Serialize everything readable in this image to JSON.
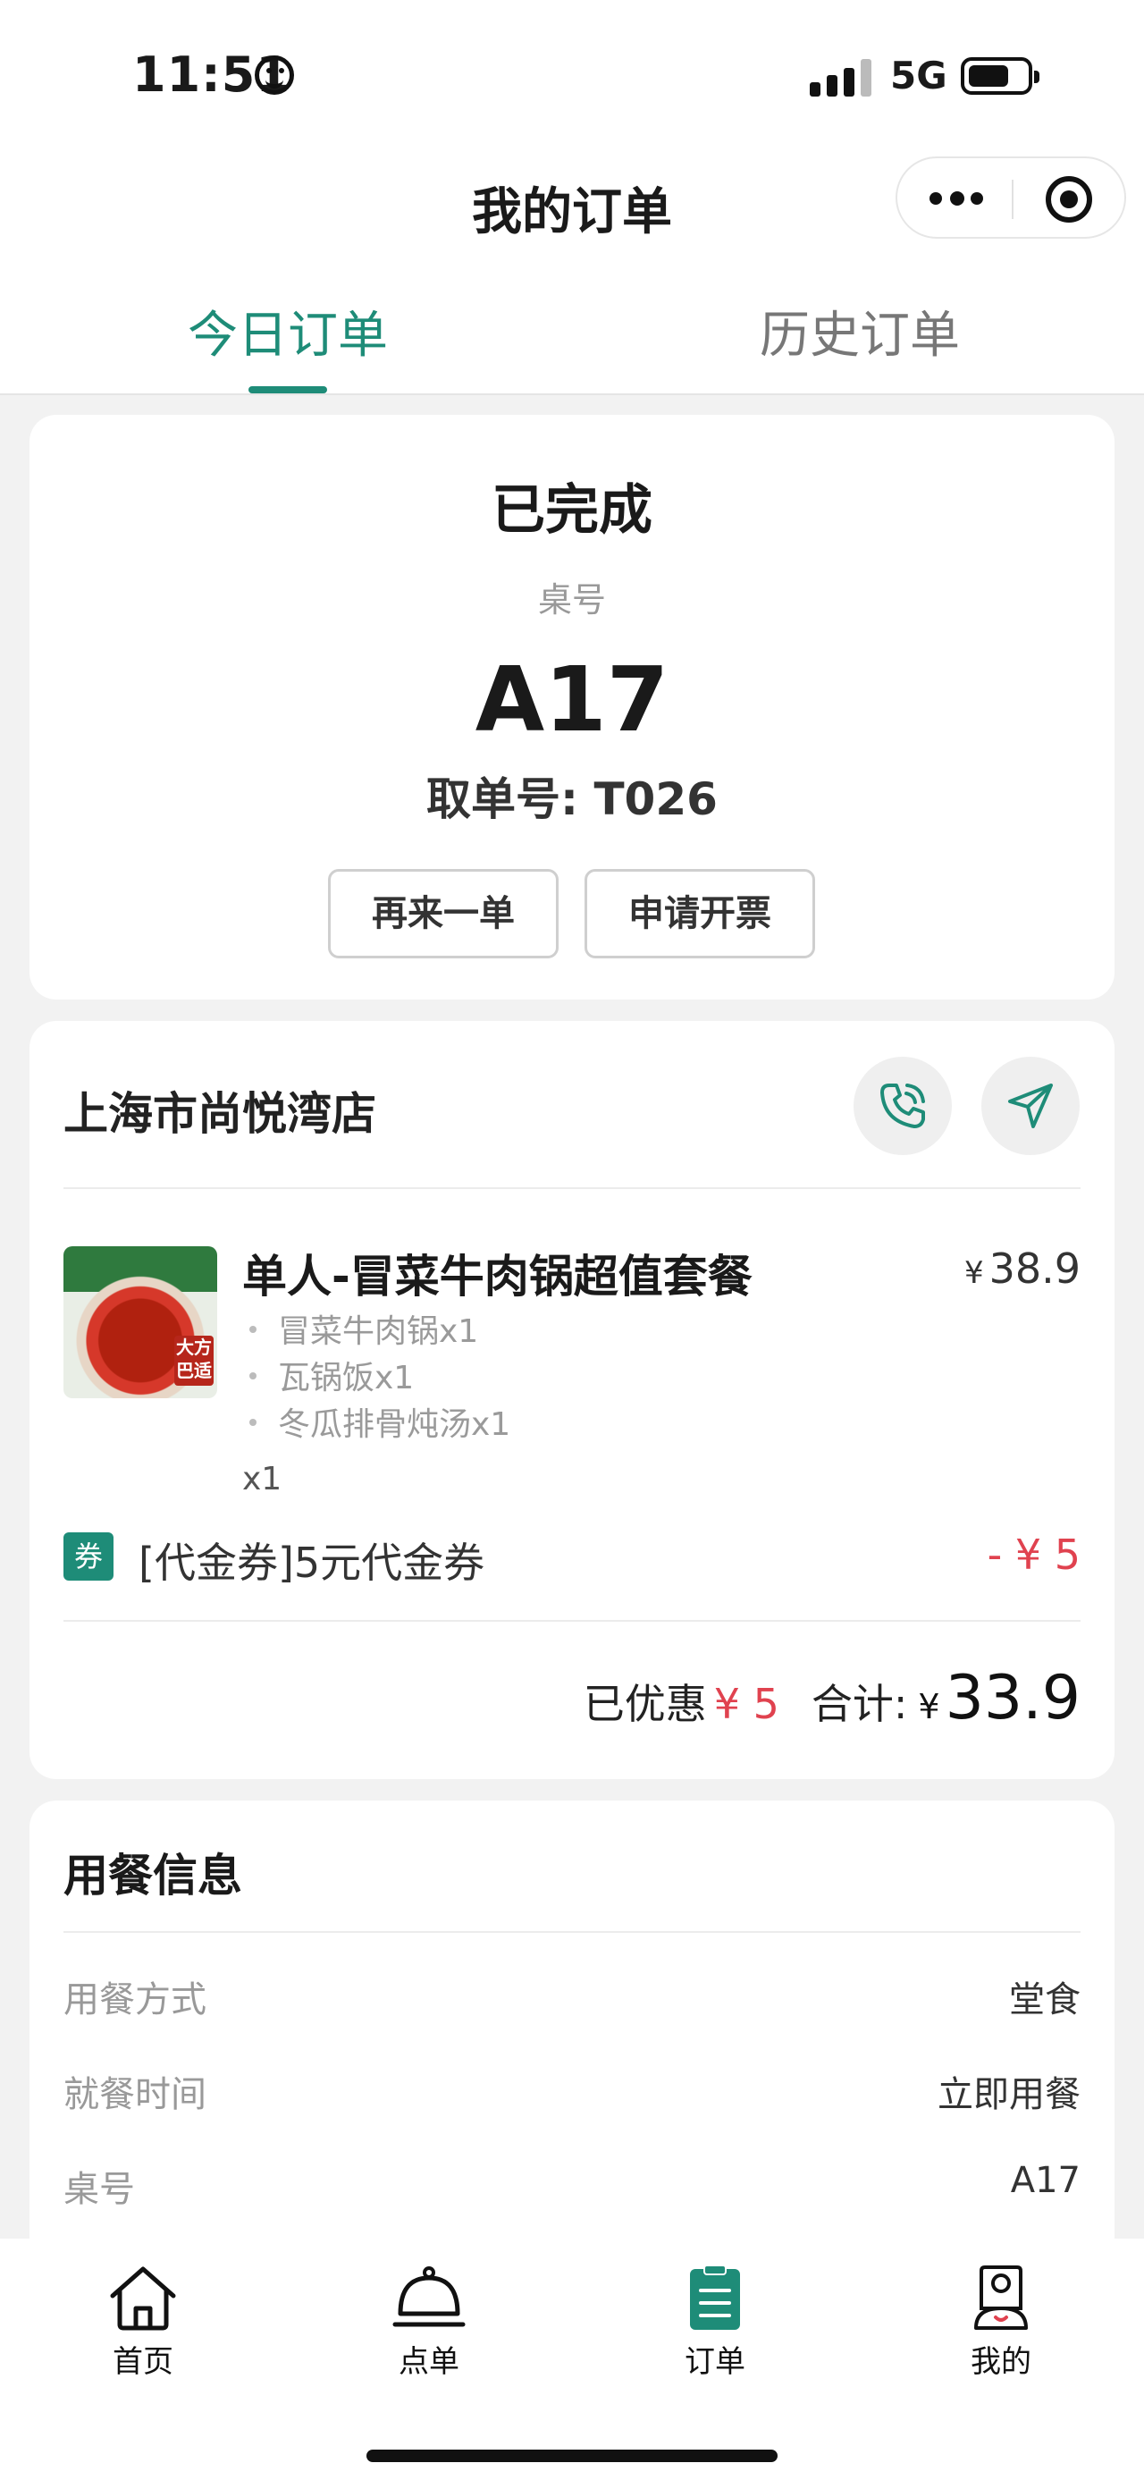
{
  "status_bar": {
    "time": "11:51",
    "network": "5G"
  },
  "nav": {
    "title": "我的订单"
  },
  "tabs": [
    {
      "label": "今日订单",
      "active": true
    },
    {
      "label": "历史订单",
      "active": false
    }
  ],
  "order_status": {
    "status": "已完成",
    "table_label": "桌号",
    "table_number": "A17",
    "pickup": "取单号: T026",
    "reorder_button": "再来一单",
    "invoice_button": "申请开票"
  },
  "store": {
    "name": "上海市尚悦湾店",
    "item": {
      "name": "单人-冒菜牛肉锅超值套餐",
      "price_symbol": "¥",
      "price": "38.9",
      "sub_items": [
        "冒菜牛肉锅x1",
        "瓦锅饭x1",
        "冬瓜排骨炖汤x1"
      ],
      "quantity": "x1",
      "image_badge": "大方巴适"
    },
    "coupon": {
      "tag": "券",
      "text": "[代金券]5元代金券",
      "amount": "- ¥ 5"
    },
    "discount_label": "已优惠",
    "discount_value": "¥ 5",
    "total_label": "合计:",
    "total_symbol": "¥",
    "total_value": "33.9"
  },
  "dining_info": {
    "title": "用餐信息",
    "rows": [
      {
        "label": "用餐方式",
        "value": "堂食"
      },
      {
        "label": "就餐时间",
        "value": "立即用餐"
      },
      {
        "label": "桌号",
        "value": "A17"
      }
    ]
  },
  "tabbar": [
    {
      "label": "首页",
      "icon": "home-icon"
    },
    {
      "label": "点单",
      "icon": "cloche-icon"
    },
    {
      "label": "订单",
      "icon": "order-clipboard-icon",
      "active": true
    },
    {
      "label": "我的",
      "icon": "profile-icon"
    }
  ],
  "colors": {
    "accent": "#1e8c78",
    "price_red": "#e0424f"
  }
}
